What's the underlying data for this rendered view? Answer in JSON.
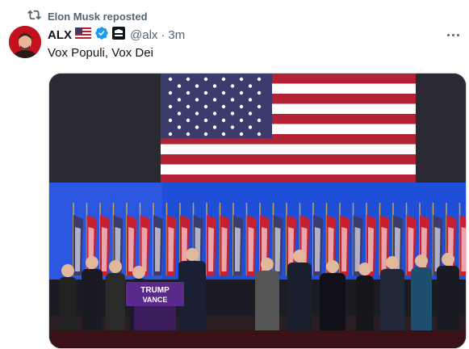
{
  "social_context": {
    "icon": "repost-icon",
    "text": "Elon Musk reposted"
  },
  "post": {
    "author_name": "ALX",
    "flag_icon": "us-flag-icon",
    "verified_icon": "verified-badge-icon",
    "affiliate_icon": "affiliate-badge-icon",
    "handle": "@alx",
    "separator": "·",
    "timestamp": "3m",
    "text": "Vox Populi, Vox Dei",
    "more_icon": "more-options-icon"
  },
  "media": {
    "podium_lines": [
      "TRUMP",
      "VANCE"
    ],
    "colors": {
      "flag_red": "#b22234",
      "flag_blue": "#3c3b6e",
      "stage_blue": "#1f4fd6",
      "podium_purple": "#5a2a8a"
    }
  },
  "colors": {
    "verified": "#1d9bf0",
    "secondary_text": "#536471"
  }
}
